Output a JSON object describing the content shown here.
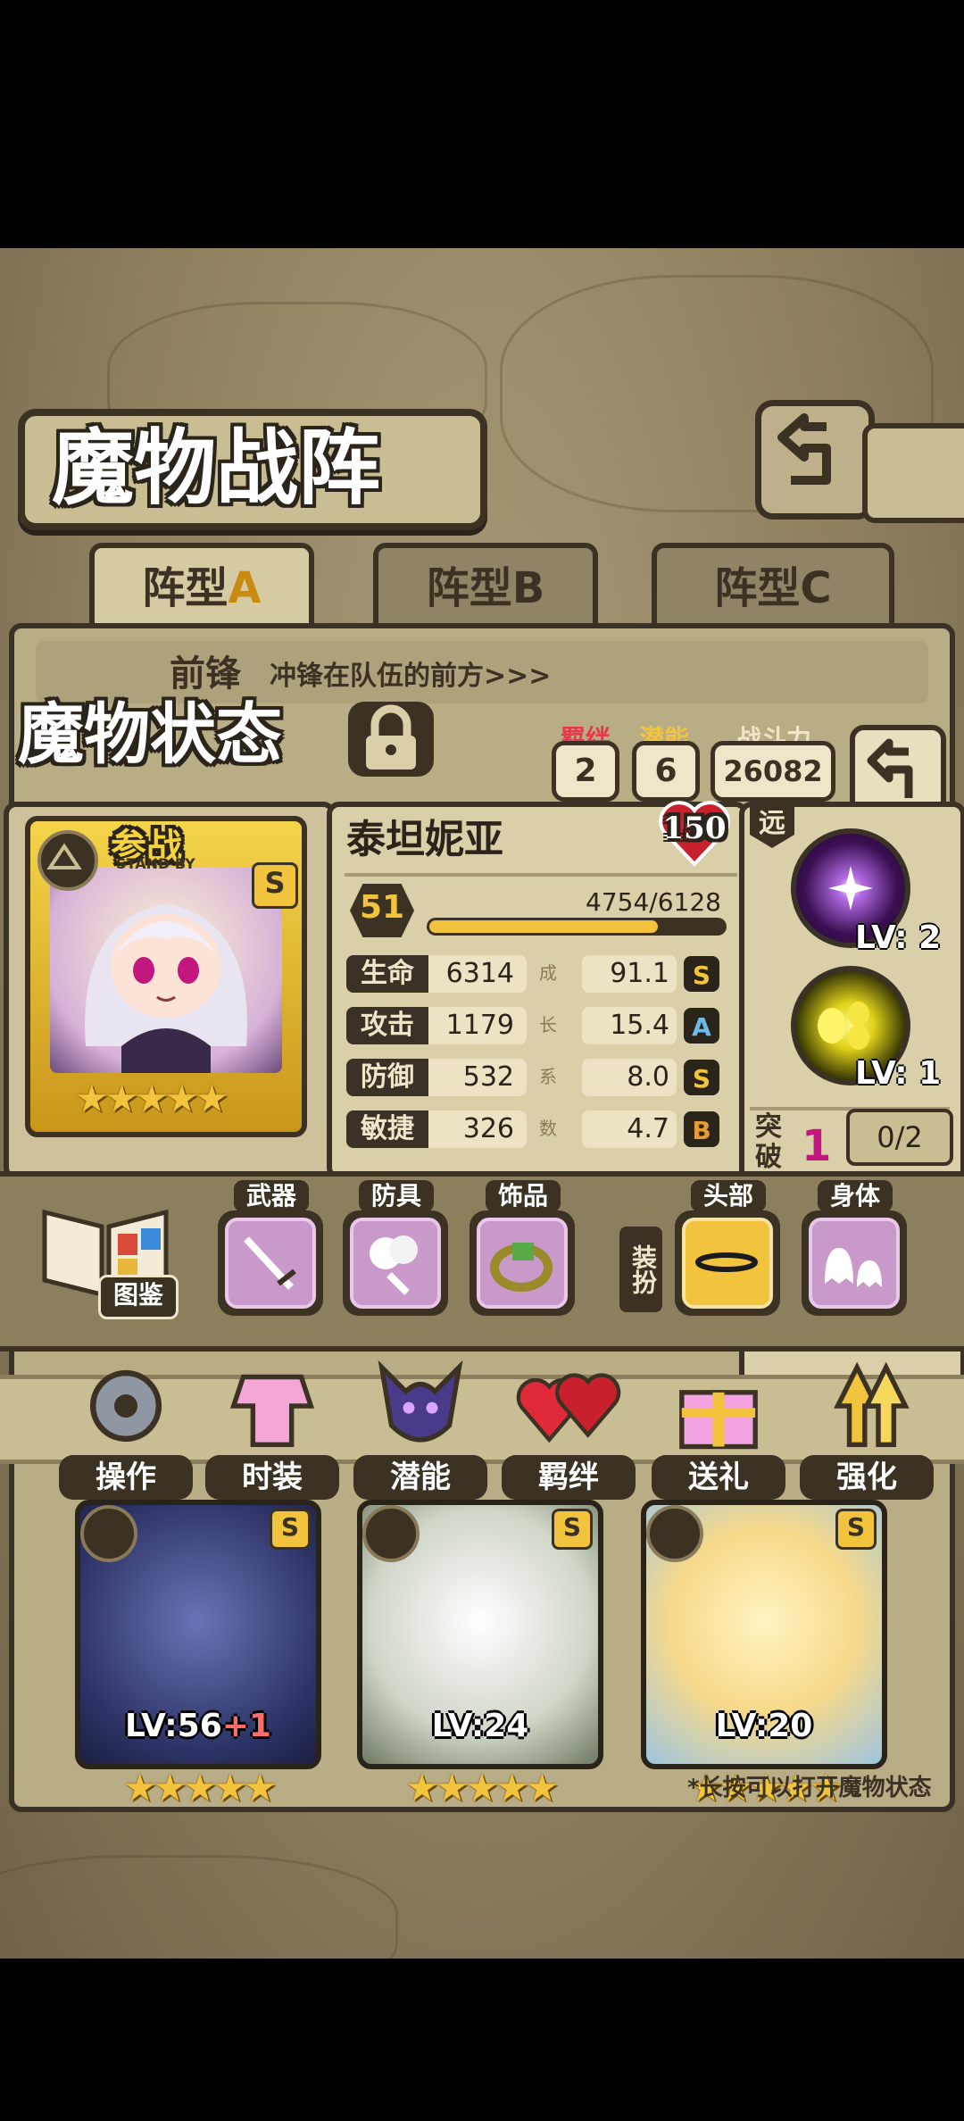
{
  "header": {
    "title": "魔物战阵",
    "back_icon": "back-arrow-icon"
  },
  "tabs": [
    {
      "label": "阵型",
      "letter": "A",
      "active": true
    },
    {
      "label": "阵型",
      "letter": "B",
      "active": false
    },
    {
      "label": "阵型",
      "letter": "C",
      "active": false
    }
  ],
  "formation": {
    "row_label": "前锋",
    "row_desc": "冲锋在队伍的前方>>>"
  },
  "status": {
    "title": "魔物状态",
    "lock_icon": "lock-icon",
    "bond_label": "羁绊",
    "bond_value": "2",
    "potential_label": "潜能",
    "potential_value": "6",
    "power_label": "战斗力",
    "power_value": "26082",
    "back_icon": "back-arrow-icon"
  },
  "monster": {
    "standby_label": "参战",
    "standby_sub": "STAND BY",
    "rank_badge": "S",
    "stars": 5,
    "name": "泰坦妮亚",
    "heart_value": "150",
    "level": "51",
    "exp_text": "4754/6128",
    "exp_fraction": 0.776,
    "range_label": "远",
    "growth_label": [
      "成",
      "长",
      "系",
      "数"
    ],
    "stats": [
      {
        "label": "生命",
        "value": "6314",
        "growth": "91.1",
        "grade": "S"
      },
      {
        "label": "攻击",
        "value": "1179",
        "growth": "15.4",
        "grade": "A"
      },
      {
        "label": "防御",
        "value": "532",
        "growth": "8.0",
        "grade": "S"
      },
      {
        "label": "敏捷",
        "value": "326",
        "growth": "4.7",
        "grade": "B"
      }
    ],
    "skills": [
      {
        "icon": "dark-star-skill-icon",
        "level": "LV: 2"
      },
      {
        "icon": "yellow-orb-skill-icon",
        "level": "LV: 1"
      }
    ],
    "breakthrough_label": "突破",
    "breakthrough_value": "1",
    "breakthrough_progress": "0/2"
  },
  "equipment": {
    "guide_label": "图鉴",
    "weapon_label": "武器",
    "armor_label": "防具",
    "accessory_label": "饰品",
    "dress_label": "装扮",
    "head_label": "头部",
    "body_label": "身体"
  },
  "actions": [
    {
      "label": "操作",
      "icon": "gear-icon"
    },
    {
      "label": "时装",
      "icon": "costume-icon"
    },
    {
      "label": "潜能",
      "icon": "demon-icon"
    },
    {
      "label": "羁绊",
      "icon": "hearts-icon"
    },
    {
      "label": "送礼",
      "icon": "gift-icon"
    },
    {
      "label": "强化",
      "icon": "upgrade-arrows-icon"
    }
  ],
  "cards": [
    {
      "level": "LV:56",
      "plus": "+1",
      "stars": 5,
      "badge": "S",
      "element": "mountain-icon"
    },
    {
      "level": "LV:24",
      "plus": "",
      "stars": 5,
      "badge": "S",
      "element": "leaf-icon"
    },
    {
      "level": "LV:20",
      "plus": "",
      "stars": 5,
      "badge": "S",
      "element": "water-icon"
    }
  ],
  "hint": "*长按可以打开魔物状态",
  "colors": {
    "gold": "#f2c33c",
    "dark_frame": "#3b3224",
    "parchment": "#d9cfa8",
    "red_heart": "#c8202c",
    "magenta": "#c2177f"
  }
}
